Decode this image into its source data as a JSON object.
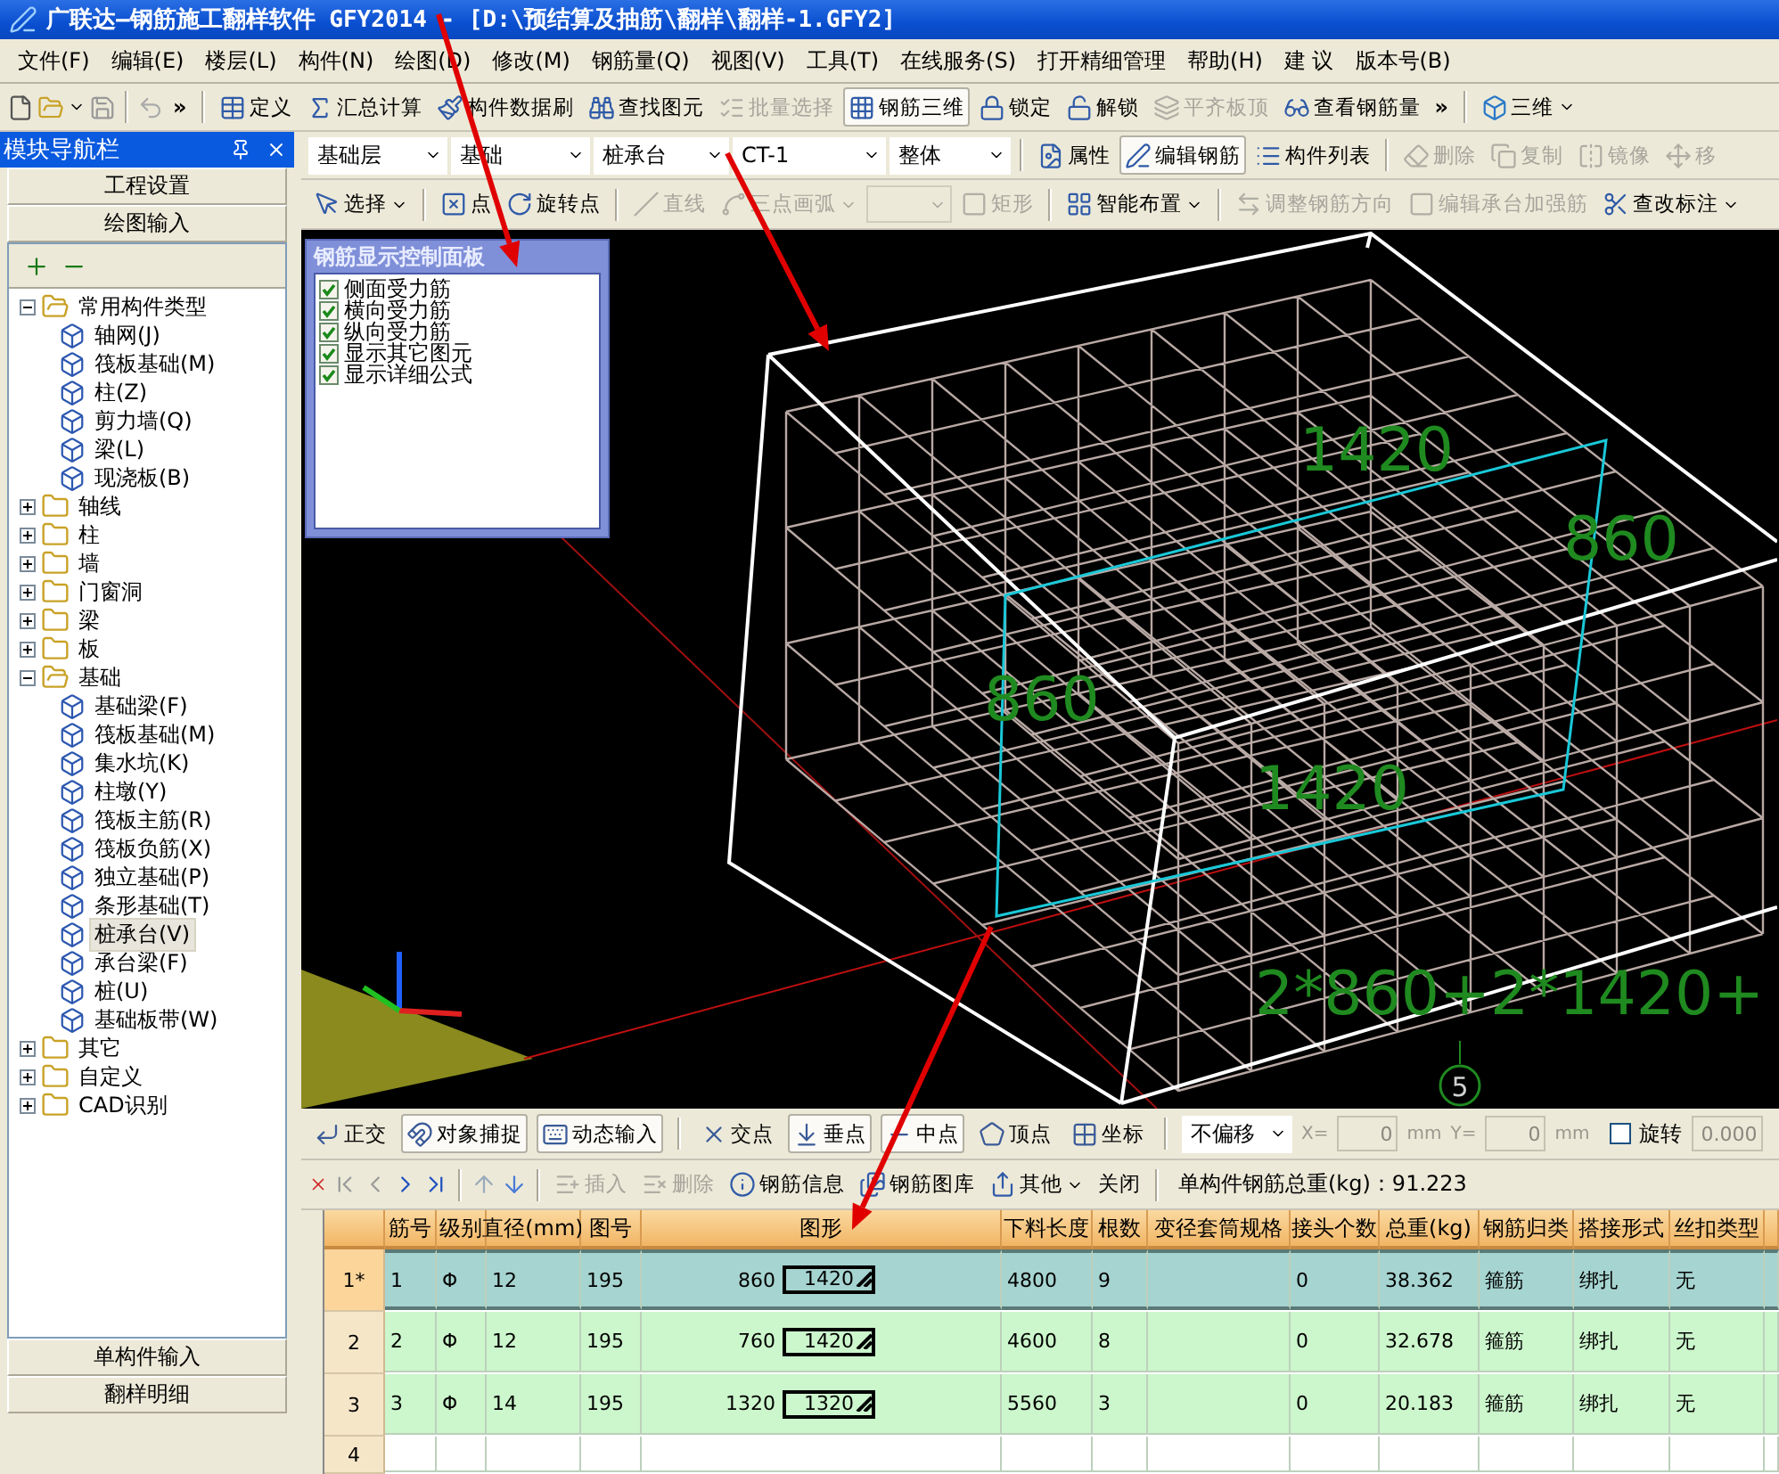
{
  "window": {
    "title": "广联达—钢筋施工翻样软件 GFY2014 - [D:\\预结算及抽筋\\翻样\\翻样-1.GFY2]"
  },
  "menu": [
    "文件(F)",
    "编辑(E)",
    "楼层(L)",
    "构件(N)",
    "绘图(D)",
    "修改(M)",
    "钢筋量(Q)",
    "视图(V)",
    "工具(T)",
    "在线服务(S)",
    "打开精细管理",
    "帮助(H)",
    "建 议",
    "版本号(B)"
  ],
  "main_toolbar": {
    "overflow_left": "»",
    "overflow_right": "»",
    "view_mode": "三维",
    "tools": [
      {
        "label": "定义",
        "disabled": false,
        "pressed": false
      },
      {
        "label": "汇总计算",
        "disabled": false,
        "pressed": false
      },
      {
        "label": "构件数据刷",
        "disabled": false,
        "pressed": false
      },
      {
        "label": "查找图元",
        "disabled": false,
        "pressed": false
      },
      {
        "label": "批量选择",
        "disabled": true,
        "pressed": false
      },
      {
        "label": "钢筋三维",
        "disabled": false,
        "pressed": true
      },
      {
        "label": "锁定",
        "disabled": false,
        "pressed": false
      },
      {
        "label": "解锁",
        "disabled": false,
        "pressed": false
      },
      {
        "label": "平齐板顶",
        "disabled": true,
        "pressed": false
      },
      {
        "label": "查看钢筋量",
        "disabled": false,
        "pressed": false
      }
    ]
  },
  "nav_panel": {
    "title": "模块导航栏",
    "sections": [
      "工程设置",
      "绘图输入"
    ],
    "tree": [
      {
        "label": "常用构件类型",
        "kind": "folder",
        "expanded": true,
        "selected": false,
        "children": [
          {
            "label": "轴网(J)",
            "kind": "component",
            "selected": false
          },
          {
            "label": "筏板基础(M)",
            "kind": "component",
            "selected": false
          },
          {
            "label": "柱(Z)",
            "kind": "component",
            "selected": false
          },
          {
            "label": "剪力墙(Q)",
            "kind": "component",
            "selected": false
          },
          {
            "label": "梁(L)",
            "kind": "component",
            "selected": false
          },
          {
            "label": "现浇板(B)",
            "kind": "component",
            "selected": false
          }
        ]
      },
      {
        "label": "轴线",
        "kind": "folder",
        "expanded": false,
        "selected": false
      },
      {
        "label": "柱",
        "kind": "folder",
        "expanded": false,
        "selected": false
      },
      {
        "label": "墙",
        "kind": "folder",
        "expanded": false,
        "selected": false
      },
      {
        "label": "门窗洞",
        "kind": "folder",
        "expanded": false,
        "selected": false
      },
      {
        "label": "梁",
        "kind": "folder",
        "expanded": false,
        "selected": false
      },
      {
        "label": "板",
        "kind": "folder",
        "expanded": false,
        "selected": false
      },
      {
        "label": "基础",
        "kind": "folder",
        "expanded": true,
        "selected": false,
        "children": [
          {
            "label": "基础梁(F)",
            "kind": "component",
            "selected": false
          },
          {
            "label": "筏板基础(M)",
            "kind": "component",
            "selected": false
          },
          {
            "label": "集水坑(K)",
            "kind": "component",
            "selected": false
          },
          {
            "label": "柱墩(Y)",
            "kind": "component",
            "selected": false
          },
          {
            "label": "筏板主筋(R)",
            "kind": "component",
            "selected": false
          },
          {
            "label": "筏板负筋(X)",
            "kind": "component",
            "selected": false
          },
          {
            "label": "独立基础(P)",
            "kind": "component",
            "selected": false
          },
          {
            "label": "条形基础(T)",
            "kind": "component",
            "selected": false
          },
          {
            "label": "桩承台(V)",
            "kind": "component",
            "selected": true
          },
          {
            "label": "承台梁(F)",
            "kind": "component",
            "selected": false
          },
          {
            "label": "桩(U)",
            "kind": "component",
            "selected": false
          },
          {
            "label": "基础板带(W)",
            "kind": "component",
            "selected": false
          }
        ]
      },
      {
        "label": "其它",
        "kind": "folder",
        "expanded": false,
        "selected": false
      },
      {
        "label": "自定义",
        "kind": "folder",
        "expanded": false,
        "selected": false
      },
      {
        "label": "CAD识别",
        "kind": "folder",
        "expanded": false,
        "selected": false
      }
    ],
    "bottom_sections": [
      "单构件输入",
      "翻样明细"
    ]
  },
  "selectors": [
    {
      "value": "基础层"
    },
    {
      "value": "基础"
    },
    {
      "value": "桩承台"
    },
    {
      "value": "CT-1"
    },
    {
      "value": "整体"
    }
  ],
  "component_tools": [
    {
      "label": "属性",
      "disabled": false,
      "pressed": false
    },
    {
      "label": "编辑钢筋",
      "disabled": false,
      "pressed": true
    },
    {
      "label": "构件列表",
      "disabled": false,
      "pressed": false
    },
    {
      "label": "删除",
      "disabled": true,
      "pressed": false
    },
    {
      "label": "复制",
      "disabled": true,
      "pressed": false
    },
    {
      "label": "镜像",
      "disabled": true,
      "pressed": false
    },
    {
      "label": "移",
      "disabled": true,
      "pressed": false
    }
  ],
  "draw_toolbar": [
    {
      "kind": "menu",
      "label": "选择",
      "disabled": false
    },
    {
      "kind": "button",
      "label": "点",
      "disabled": false
    },
    {
      "kind": "button",
      "label": "旋转点",
      "disabled": false
    },
    {
      "kind": "button",
      "label": "直线",
      "disabled": true
    },
    {
      "kind": "menu",
      "label": "三点画弧",
      "disabled": true
    },
    {
      "kind": "combo",
      "disabled": true
    },
    {
      "kind": "button",
      "label": "矩形",
      "disabled": true
    },
    {
      "kind": "menu",
      "label": "智能布置",
      "disabled": false
    },
    {
      "kind": "button",
      "label": "调整钢筋方向",
      "disabled": true
    },
    {
      "kind": "button",
      "label": "编辑承台加强筋",
      "disabled": true
    },
    {
      "kind": "menu",
      "label": "查改标注",
      "disabled": false
    }
  ],
  "rebar_panel": {
    "title": "钢筋显示控制面板",
    "options": [
      {
        "label": "侧面受力筋",
        "checked": true
      },
      {
        "label": "横向受力筋",
        "checked": true
      },
      {
        "label": "纵向受力筋",
        "checked": true
      },
      {
        "label": "显示其它图元",
        "checked": true
      },
      {
        "label": "显示详细公式",
        "checked": true
      }
    ]
  },
  "view_labels": [
    "1420",
    "860",
    "860",
    "1420",
    "2*860+2*1420+"
  ],
  "axis_marker": "5",
  "snap_toolbar": {
    "tools": [
      {
        "label": "正交",
        "selected": false
      },
      {
        "label": "对象捕捉",
        "selected": true
      },
      {
        "label": "动态输入",
        "selected": true
      },
      {
        "label": "交点",
        "selected": false
      },
      {
        "label": "垂点",
        "selected": true
      },
      {
        "label": "中点",
        "selected": true
      },
      {
        "label": "顶点",
        "selected": false
      },
      {
        "label": "坐标",
        "selected": false
      }
    ],
    "offset": "不偏移",
    "x_label": "X=",
    "x_value": "0",
    "x_unit": "mm",
    "y_label": "Y=",
    "y_value": "0",
    "y_unit": "mm",
    "rotate_label": "旋转",
    "rotate_checked": false,
    "angle": "0.000"
  },
  "rebar_toolbar": {
    "tools": [
      {
        "kind": "button",
        "label": "插入",
        "disabled": true
      },
      {
        "kind": "button",
        "label": "删除",
        "disabled": true
      },
      {
        "kind": "button",
        "label": "钢筋信息",
        "disabled": false
      },
      {
        "kind": "button",
        "label": "钢筋图库",
        "disabled": false
      },
      {
        "kind": "menu",
        "label": "其他",
        "disabled": false
      },
      {
        "kind": "plain",
        "label": "关闭",
        "disabled": false
      }
    ],
    "total": "单构件钢筋总重(kg)：91.223"
  },
  "table": {
    "columns": [
      "筋号",
      "级别",
      "直径(mm)",
      "图号",
      "图形",
      "下料长度",
      "根数",
      "变径套筒规格",
      "接头个数",
      "总重(kg)",
      "钢筋归类",
      "搭接形式",
      "丝扣类型"
    ],
    "rows": [
      {
        "header": "1*",
        "kind": "data",
        "selected": true,
        "no": "1",
        "grade": "Φ",
        "diameter": "12",
        "figure": "195",
        "shape_side": "860",
        "shape_length": "1420",
        "length": "4800",
        "count": "9",
        "joints": "0",
        "weight": "38.362",
        "category": "箍筋",
        "splice": "绑扎",
        "thread": "无"
      },
      {
        "header": "2",
        "kind": "data",
        "selected": false,
        "no": "2",
        "grade": "Φ",
        "diameter": "12",
        "figure": "195",
        "shape_side": "760",
        "shape_length": "1420",
        "length": "4600",
        "count": "8",
        "joints": "0",
        "weight": "32.678",
        "category": "箍筋",
        "splice": "绑扎",
        "thread": "无"
      },
      {
        "header": "3",
        "kind": "data",
        "selected": false,
        "no": "3",
        "grade": "Φ",
        "diameter": "14",
        "figure": "195",
        "shape_side": "1320",
        "shape_length": "1320",
        "length": "5560",
        "count": "3",
        "joints": "0",
        "weight": "20.183",
        "category": "箍筋",
        "splice": "绑扎",
        "thread": "无"
      },
      {
        "header": "4",
        "kind": "new",
        "selected": false
      }
    ]
  }
}
